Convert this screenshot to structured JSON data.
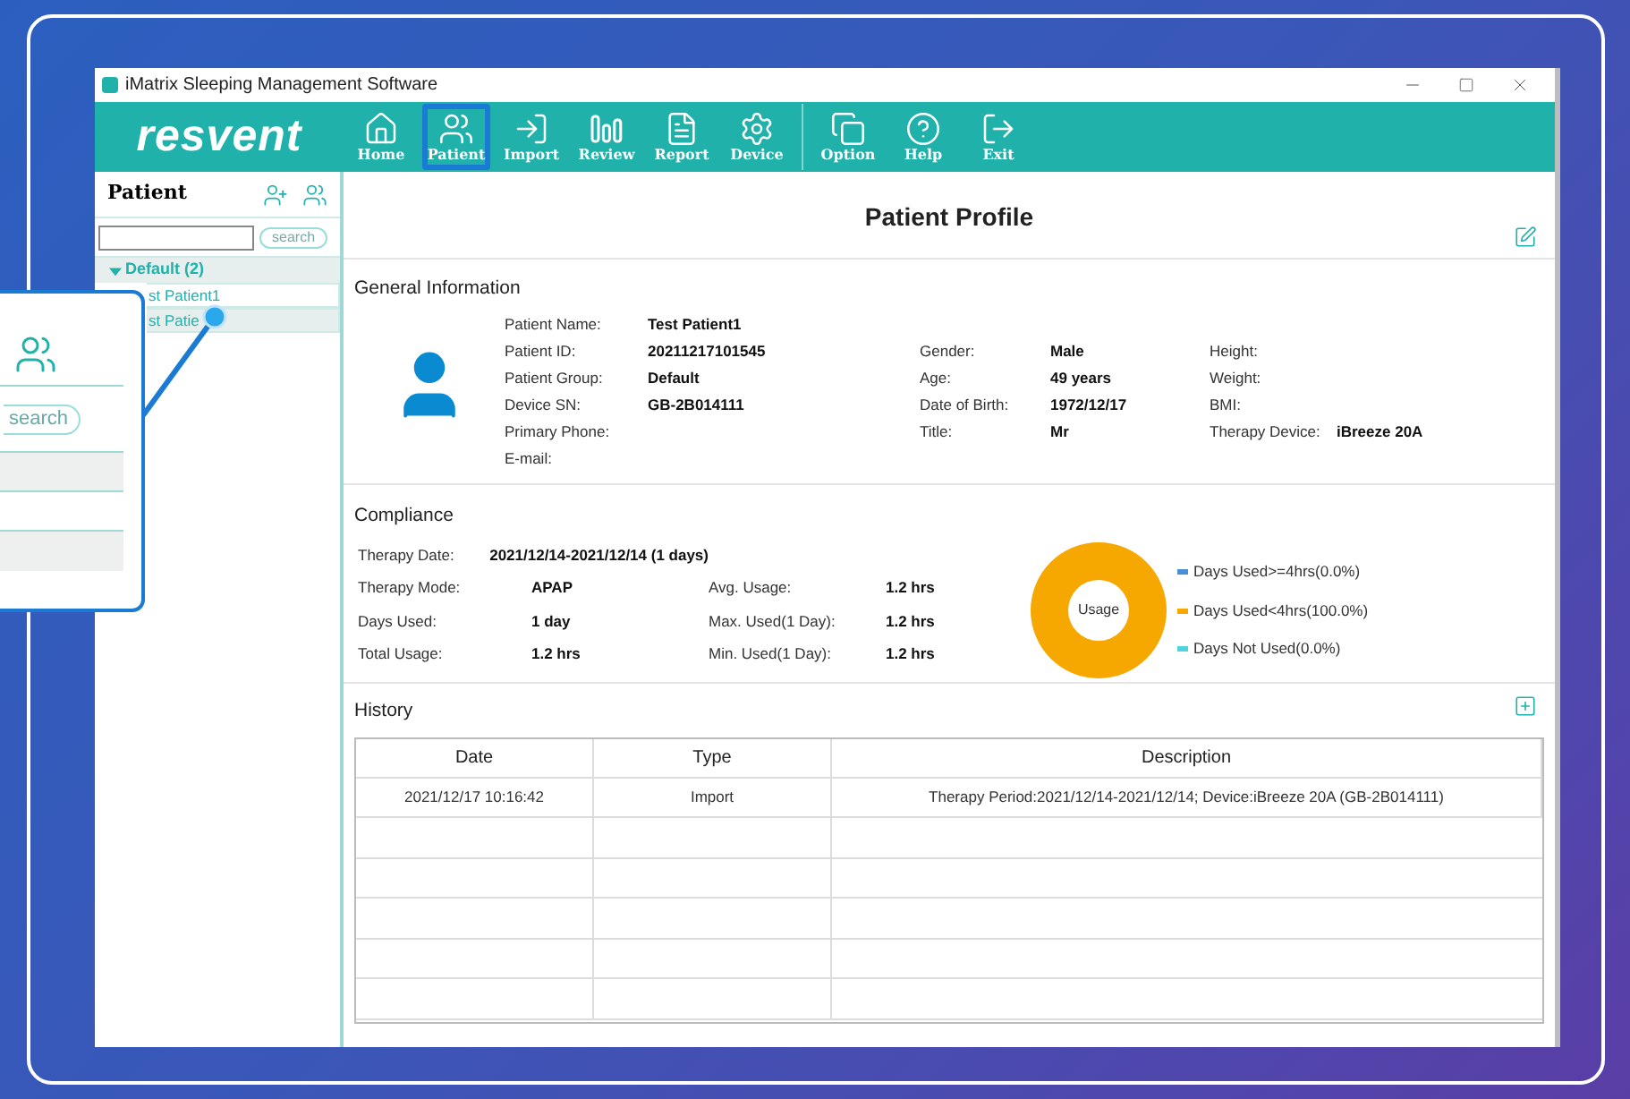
{
  "window": {
    "title": "iMatrix Sleeping Management Software"
  },
  "toolbar": {
    "logo": "resvent",
    "groups": [
      [
        {
          "label": "Home",
          "selected": false
        },
        {
          "label": "Patient",
          "selected": true
        },
        {
          "label": "Import",
          "selected": false
        },
        {
          "label": "Review",
          "selected": false
        },
        {
          "label": "Report",
          "selected": false
        },
        {
          "label": "Device",
          "selected": false
        }
      ],
      [
        {
          "label": "Option",
          "selected": false
        },
        {
          "label": "Help",
          "selected": false
        },
        {
          "label": "Exit",
          "selected": false
        }
      ]
    ]
  },
  "sidebar": {
    "title": "Patient",
    "search_button": "search",
    "tree": [
      {
        "label": "Default (2)",
        "expanded": true,
        "children": [
          {
            "label": "st Patient1",
            "selected": false
          },
          {
            "label": "st Patie",
            "selected": true
          }
        ]
      }
    ]
  },
  "callout": {
    "search_button": "search"
  },
  "profile": {
    "title": "Patient Profile",
    "general": {
      "title": "General Information",
      "columns": [
        [
          {
            "label": "Patient Name:",
            "value": "Test Patient1"
          },
          {
            "label": "Patient ID:",
            "value": "20211217101545"
          },
          {
            "label": "Patient Group:",
            "value": "Default"
          },
          {
            "label": "Device SN:",
            "value": "GB-2B014111"
          },
          {
            "label": "Primary Phone:"
          },
          {
            "label": "E-mail:"
          }
        ],
        [
          {
            "label": "Gender:",
            "value": "Male"
          },
          {
            "label": "Age:",
            "value": "49 years"
          },
          {
            "label": "Date of Birth:",
            "value": "1972/12/17"
          },
          {
            "label": "Title:",
            "value": "Mr"
          }
        ],
        [
          {
            "label": "Height:"
          },
          {
            "label": "Weight:"
          },
          {
            "label": "BMI:"
          },
          {
            "label": "Therapy Device:",
            "value": "iBreeze 20A"
          }
        ]
      ]
    },
    "compliance": {
      "title": "Compliance",
      "rows": [
        [
          {
            "label": "Therapy Date:",
            "value": "2021/12/14-2021/12/14 (1 days)"
          }
        ],
        [
          {
            "label": "Therapy Mode:",
            "value": "APAP"
          },
          {
            "label": "Avg. Usage:",
            "value": "1.2 hrs"
          }
        ],
        [
          {
            "label": "Days Used:",
            "value": "1 day"
          },
          {
            "label": "Max. Used(1 Day):",
            "value": "1.2 hrs"
          }
        ],
        [
          {
            "label": "Total Usage:",
            "value": "1.2 hrs"
          },
          {
            "label": "Min. Used(1 Day):",
            "value": "1.2 hrs"
          }
        ]
      ],
      "chart_data": {
        "type": "pie",
        "categories": [
          "Days Used>=4hrs(0.0%)",
          "Days Used<4hrs(100.0%)",
          "Days Not Used(0.0%)"
        ],
        "series": [
          {
            "name": "Usage",
            "values": [
              0,
              100,
              0
            ]
          }
        ],
        "colors": [
          "#4a8fd6",
          "#f7a800",
          "#4fd3de"
        ]
      }
    },
    "history": {
      "title": "History",
      "columns": [
        "Date",
        "Type",
        "Description"
      ],
      "rows": [
        [
          "2021/12/17 10:16:42",
          "Import",
          "Therapy Period:2021/12/14-2021/12/14; Device:iBreeze 20A (GB-2B014111)"
        ]
      ]
    }
  }
}
